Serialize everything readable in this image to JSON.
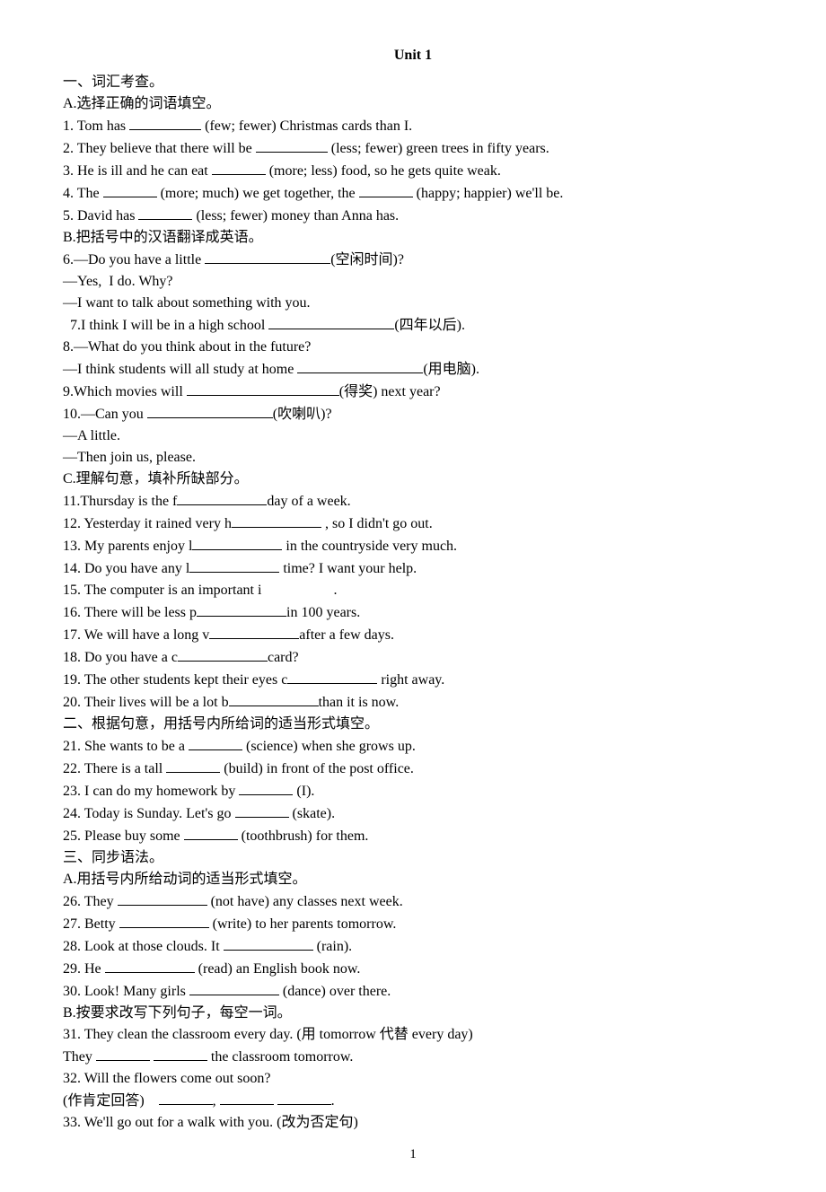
{
  "title": "Unit 1",
  "section1_heading": "一、词汇考查。",
  "sectionA_heading": "A.选择正确的词语填空。",
  "q1": "1. Tom has ",
  "q1b": " (few; fewer) Christmas cards than I.",
  "q2": "2. They believe that there will be ",
  "q2b": " (less; fewer) green trees in fifty years.",
  "q3": "3. He is ill and he can eat ",
  "q3b": " (more; less) food, so he gets quite weak.",
  "q4": "4. The ",
  "q4b": " (more; much) we get together, the ",
  "q4c": " (happy; happier) we'll be.",
  "q5": "5. David has ",
  "q5b": " (less; fewer) money than Anna has.",
  "sectionB_heading": "B.把括号中的汉语翻译成英语。",
  "q6": "6.—Do you have a little ",
  "q6b": "(空闲时间)?",
  "q6_r1": "—Yes,  I do. Why?",
  "q6_r2": "—I want to talk about something with you.",
  "q7": "  7.I think I will be in a high school ",
  "q7b": "(四年以后).",
  "q8": "8.—What do you think about in the future?",
  "q8_r1": "—I think students will all study at home ",
  "q8_r1b": "(用电脑).",
  "q9": "9.Which movies will ",
  "q9b": "(得奖) next year?",
  "q10": "10.—Can you ",
  "q10b": "(吹喇叭)?",
  "q10_r1": "—A little.",
  "q10_r2": "—Then join us, please.",
  "sectionC_heading": "C.理解句意，填补所缺部分。",
  "q11": "11.Thursday is the f",
  "q11b": "day of a week.",
  "q12": "12. Yesterday it rained very h",
  "q12b": " , so I didn't go out.",
  "q13": "13. My parents enjoy l",
  "q13b": " in the countryside very much.",
  "q14": "14. Do you have any l",
  "q14b": " time? I want your help.",
  "q15": "15. The computer is an important i",
  "q15b": ".",
  "q16": "16. There will be less p",
  "q16b": "in 100 years.",
  "q17": "17. We will have a long v",
  "q17b": "after a few days.",
  "q18": "18. Do you have a c",
  "q18b": "card?",
  "q19": "19. The other students kept their eyes c",
  "q19b": " right away.",
  "q20": "20. Their lives will be a lot b",
  "q20b": "than it is now.",
  "section2_heading": "二、根据句意，用括号内所给词的适当形式填空。",
  "q21": "21. She wants to be a ",
  "q21b": " (science) when she grows up.",
  "q22": "22. There is a tall ",
  "q22b": " (build) in front of the post office.",
  "q23": "23. I can do my homework by ",
  "q23b": " (I).",
  "q24": "24. Today is Sunday. Let's go ",
  "q24b": " (skate).",
  "q25": "25. Please buy some ",
  "q25b": " (toothbrush) for them.",
  "section3_heading": "三、同步语法。",
  "section3A_heading": "A.用括号内所给动词的适当形式填空。",
  "q26": "26. They ",
  "q26b": " (not have) any classes next week.",
  "q27": "27. Betty ",
  "q27b": " (write) to her parents tomorrow.",
  "q28": "28. Look at those clouds. It ",
  "q28b": " (rain).",
  "q29": "29. He ",
  "q29b": " (read) an English book now.",
  "q30": "30. Look! Many girls ",
  "q30b": " (dance) over there.",
  "section3B_heading": "B.按要求改写下列句子，每空一词。",
  "q31": "31. They clean the classroom every day. (用 tomorrow 代替 every day)",
  "q31_r1": "They ",
  "q31_r1b": " the classroom tomorrow.",
  "q32": "32. Will the flowers come out soon?",
  "q32_r1a": "(作肯定回答)    ",
  "q32_r1b": ", ",
  "q32_r1c": " ",
  "q32_r1d": ".",
  "q33": "33. We'll go out for a walk with you. (改为否定句)",
  "page_number": "1"
}
